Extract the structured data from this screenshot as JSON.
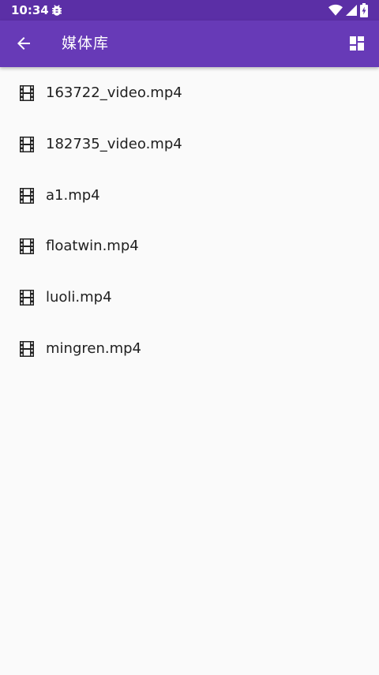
{
  "status_bar": {
    "time": "10:34",
    "icons": [
      "bug-icon",
      "wifi-icon",
      "cell-signal-icon",
      "battery-icon"
    ]
  },
  "app_bar": {
    "title": "媒体库",
    "back_icon": "arrow-back-icon",
    "action_icon": "dashboard-icon"
  },
  "files": [
    {
      "name": "163722_video.mp4",
      "icon": "film-icon"
    },
    {
      "name": "182735_video.mp4",
      "icon": "film-icon"
    },
    {
      "name": "a1.mp4",
      "icon": "film-icon"
    },
    {
      "name": "floatwin.mp4",
      "icon": "film-icon"
    },
    {
      "name": "luoli.mp4",
      "icon": "film-icon"
    },
    {
      "name": "mingren.mp4",
      "icon": "film-icon"
    }
  ],
  "colors": {
    "status_bar": "#5b2fa6",
    "app_bar": "#673ab7",
    "background": "#fafafa",
    "text": "#212121"
  }
}
